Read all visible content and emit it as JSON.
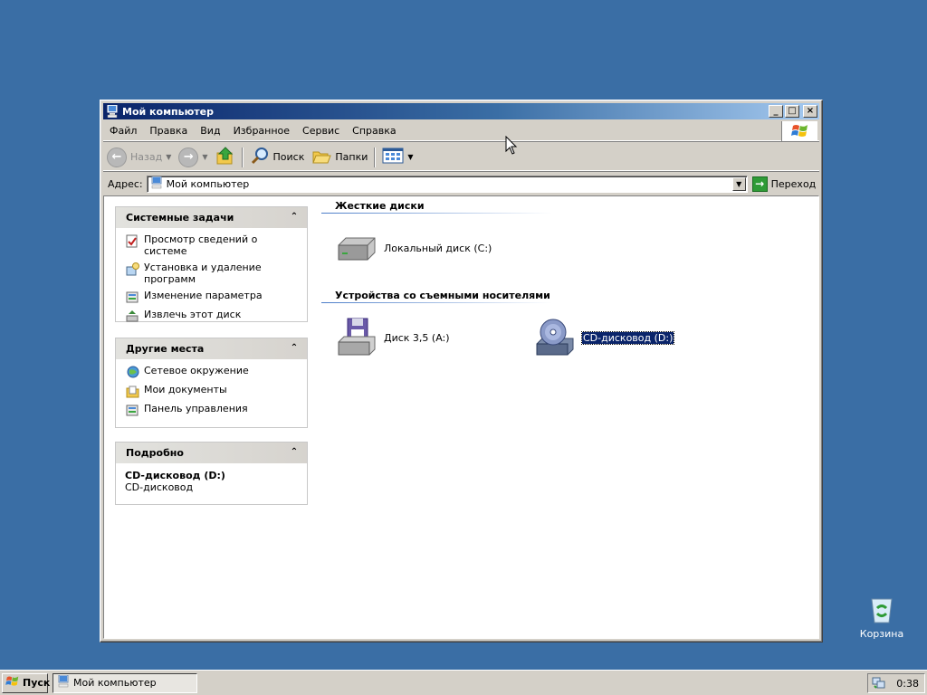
{
  "window": {
    "title": "Мой компьютер",
    "controls": {
      "minimize": "_",
      "maximize": "□",
      "close": "×"
    }
  },
  "menu": {
    "items": [
      "Файл",
      "Правка",
      "Вид",
      "Избранное",
      "Сервис",
      "Справка"
    ]
  },
  "toolbar": {
    "back_label": "Назад",
    "search_label": "Поиск",
    "folders_label": "Папки"
  },
  "address": {
    "label": "Адрес:",
    "value": "Мой компьютер",
    "go_label": "Переход"
  },
  "panes": {
    "system_tasks": {
      "title": "Системные задачи",
      "items": [
        "Просмотр сведений о системе",
        "Установка и удаление программ",
        "Изменение параметра",
        "Извлечь этот диск"
      ]
    },
    "other_places": {
      "title": "Другие места",
      "items": [
        "Сетевое окружение",
        "Мои документы",
        "Панель управления"
      ]
    },
    "details": {
      "title": "Подробно",
      "name": "CD-дисковод (D:)",
      "type": "CD-дисковод"
    }
  },
  "groups": {
    "hard_disks": {
      "title": "Жесткие диски",
      "drives": [
        "Локальный диск (C:)"
      ]
    },
    "removable": {
      "title": "Устройства со съемными носителями",
      "drives": [
        "Диск 3,5 (A:)",
        "CD-дисковод (D:)"
      ]
    }
  },
  "desktop": {
    "recycle_bin": "Корзина"
  },
  "taskbar": {
    "start_label": "Пуск",
    "task_label": "Мой компьютер",
    "clock": "0:38"
  }
}
